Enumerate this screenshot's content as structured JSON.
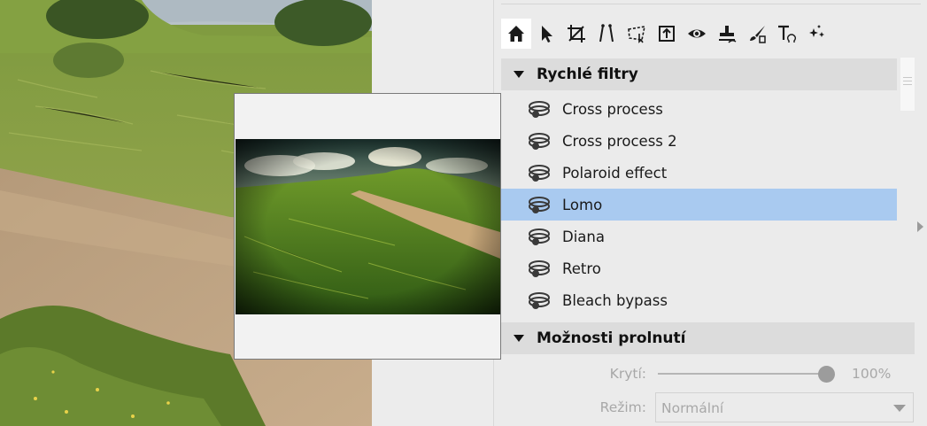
{
  "toolbar": {
    "tools": [
      "home-icon",
      "pointer-icon",
      "crop-icon",
      "line-tool-icon",
      "transform-icon",
      "export-icon",
      "eye-icon",
      "stamp-icon",
      "brush-icon",
      "text-symbol-icon",
      "sparkle-icon"
    ],
    "active_tool": "home-icon"
  },
  "quick_filters": {
    "title": "Rychlé filtry",
    "items": [
      {
        "label": "Cross process"
      },
      {
        "label": "Cross process 2"
      },
      {
        "label": "Polaroid effect"
      },
      {
        "label": "Lomo"
      },
      {
        "label": "Diana"
      },
      {
        "label": "Retro"
      },
      {
        "label": "Bleach bypass"
      }
    ],
    "selected_index": 3
  },
  "blend_options": {
    "title": "Možnosti prolnutí",
    "opacity_label": "Krytí:",
    "opacity_value": "100%",
    "opacity_fraction": 1.0,
    "mode_label": "Režim:",
    "mode_value": "Normální"
  },
  "colors": {
    "selection": "#a9caf0",
    "panel_bg": "#ebebeb",
    "section_header_bg": "#dcdcdc",
    "disabled_text": "#a8a8a8"
  }
}
